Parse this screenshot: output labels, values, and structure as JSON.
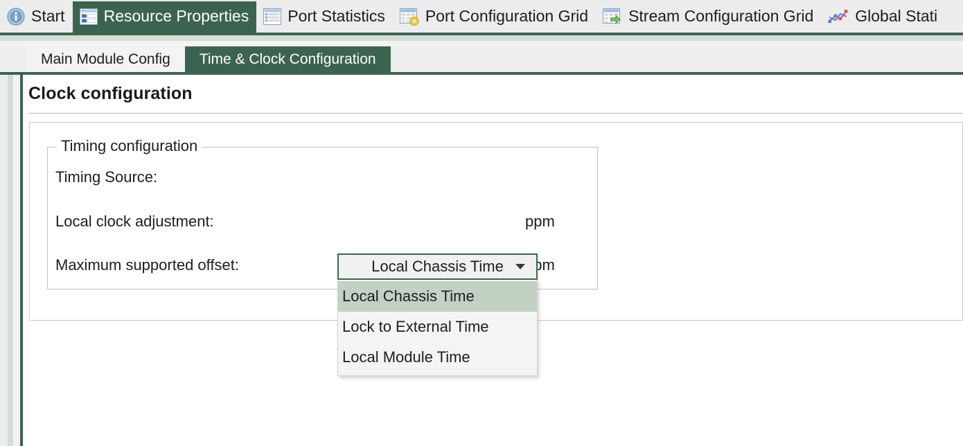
{
  "main_tabs": [
    {
      "label": "Start",
      "icon": "info-circle-icon",
      "active": false
    },
    {
      "label": "Resource Properties",
      "icon": "properties-grid-icon",
      "active": true
    },
    {
      "label": "Port Statistics",
      "icon": "list-grid-icon",
      "active": false
    },
    {
      "label": "Port Configuration Grid",
      "icon": "grid-settings-icon",
      "active": false
    },
    {
      "label": "Stream Configuration Grid",
      "icon": "grid-arrow-icon",
      "active": false
    },
    {
      "label": "Global Stati",
      "icon": "scatter-chart-icon",
      "active": false
    }
  ],
  "sub_tabs": [
    {
      "label": "Main Module Config",
      "active": false
    },
    {
      "label": "Time & Clock Configuration",
      "active": true
    }
  ],
  "page": {
    "title": "Clock configuration"
  },
  "timing_group": {
    "legend": "Timing configuration",
    "rows": [
      {
        "label": "Timing Source:",
        "unit": ""
      },
      {
        "label": "Local clock adjustment:",
        "unit": "ppm"
      },
      {
        "label": "Maximum supported offset:",
        "unit": "ppm"
      }
    ]
  },
  "timing_source_combo": {
    "value": "Local Chassis Time",
    "expanded": true,
    "options": [
      {
        "label": "Local Chassis Time",
        "selected": true
      },
      {
        "label": "Lock to External Time",
        "selected": false
      },
      {
        "label": "Local Module Time",
        "selected": false
      }
    ]
  },
  "colors": {
    "accent_green": "#3c6350",
    "sage": "#d3ddd6",
    "highlight": "#c3d1c5",
    "chrome_gray": "#ececec"
  }
}
